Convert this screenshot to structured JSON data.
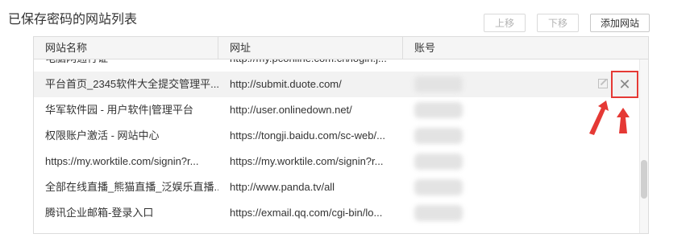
{
  "header": {
    "title": "已保存密码的网站列表",
    "up_label": "上移",
    "down_label": "下移",
    "add_label": "添加网站"
  },
  "table": {
    "columns": [
      "网站名称",
      "网址",
      "账号"
    ],
    "rows": [
      {
        "name": "电脑网通行证",
        "url": "http://my.pconline.com.cn/login.j..."
      },
      {
        "name": "平台首页_2345软件大全提交管理平...",
        "url": "http://submit.duote.com/"
      },
      {
        "name": "华军软件园 - 用户软件|管理平台",
        "url": "http://user.onlinedown.net/"
      },
      {
        "name": "权限账户激活 - 网站中心",
        "url": "https://tongji.baidu.com/sc-web/..."
      },
      {
        "name": "https://my.worktile.com/signin?r...",
        "url": "https://my.worktile.com/signin?r..."
      },
      {
        "name": "全部在线直播_熊猫直播_泛娱乐直播...",
        "url": "http://www.panda.tv/all"
      },
      {
        "name": "腾讯企业邮箱-登录入口",
        "url": "https://exmail.qq.com/cgi-bin/lo..."
      },
      {
        "name": "",
        "url": ""
      }
    ]
  },
  "icons": {
    "edit": "edit-icon",
    "close": "close-icon",
    "close_glyph": "✕"
  },
  "colors": {
    "annotation": "#e53935"
  }
}
